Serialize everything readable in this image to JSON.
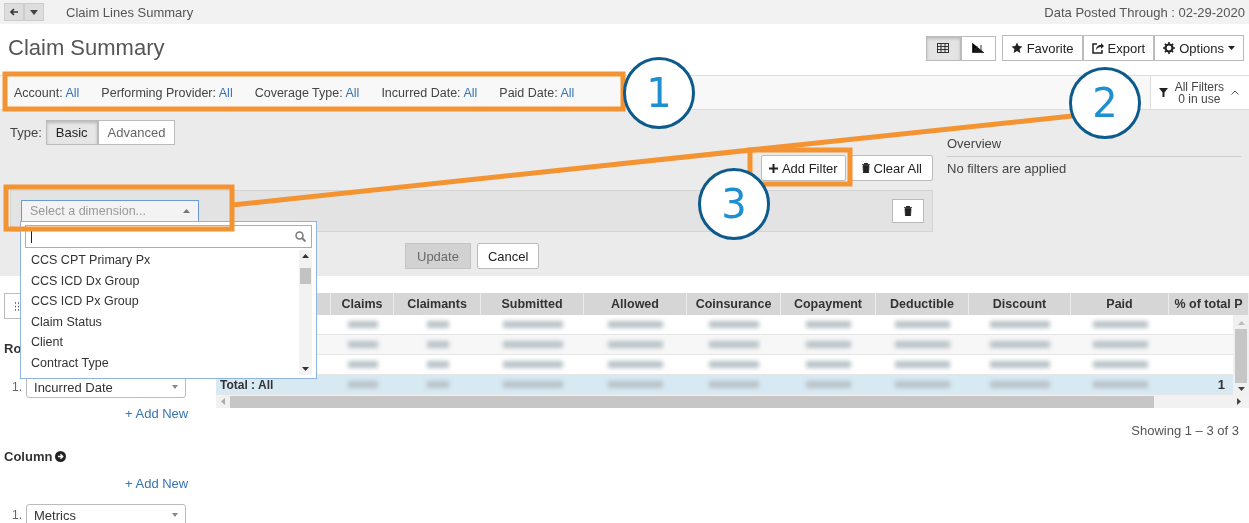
{
  "breadcrumb": "Claim Lines Summary",
  "data_posted": "Data Posted Through : 02-29-2020",
  "title": "Claim Summary",
  "view_toggle": [
    {
      "kind": "table",
      "selected": true
    },
    {
      "kind": "chart",
      "selected": false
    }
  ],
  "actions": [
    {
      "kind": "favorite",
      "label": "Favorite"
    },
    {
      "kind": "export",
      "label": "Export"
    },
    {
      "kind": "options",
      "label": "Options"
    }
  ],
  "filter_bar": {
    "filters": [
      {
        "label": "Account:",
        "value": "All"
      },
      {
        "label": "Performing Provider:",
        "value": "All"
      },
      {
        "label": "Coverage Type:",
        "value": "All"
      },
      {
        "label": "Incurred Date:",
        "value": "All"
      },
      {
        "label": "Paid Date:",
        "value": "All"
      }
    ],
    "all_filters": "All Filters",
    "in_use": "0 in use"
  },
  "filter_panel": {
    "type_label": "Type:",
    "types": [
      {
        "label": "Basic",
        "selected": true
      },
      {
        "label": "Advanced",
        "selected": false
      }
    ],
    "add_filter": "Add Filter",
    "clear_all": "Clear All",
    "dimension_placeholder": "Select a dimension...",
    "update": {
      "label": "Update",
      "disabled": true
    },
    "cancel": "Cancel",
    "overview_title": "Overview",
    "overview_text": "No filters are applied"
  },
  "dropdown": {
    "items": [
      "CCS CPT Primary Px",
      "CCS ICD Dx Group",
      "CCS ICD Px Group",
      "Claim Status",
      "Client",
      "Contract Type"
    ]
  },
  "sidebar": {
    "row_heading": "Ro",
    "row_index": "1.",
    "row_select": "Incurred Date",
    "add_new_row": "+ Add New",
    "column_heading": "Column",
    "add_new_column": "+ Add New",
    "column_index": "1.",
    "column_select": "Metrics"
  },
  "table": {
    "columns": [
      "Claims",
      "Claimants",
      "Submitted",
      "Allowed",
      "Coinsurance",
      "Copayment",
      "Deductible",
      "Discount",
      "Paid",
      "% of total P"
    ],
    "rows": [
      {
        "kind": "blurred"
      },
      {
        "kind": "blurred"
      },
      {
        "kind": "blurred"
      },
      {
        "kind": "total",
        "label": "Total : All",
        "last": "1"
      }
    ],
    "footer": "Showing 1 – 3 of 3"
  },
  "annotations": [
    {
      "number": "1"
    },
    {
      "number": "2"
    },
    {
      "number": "3"
    }
  ]
}
